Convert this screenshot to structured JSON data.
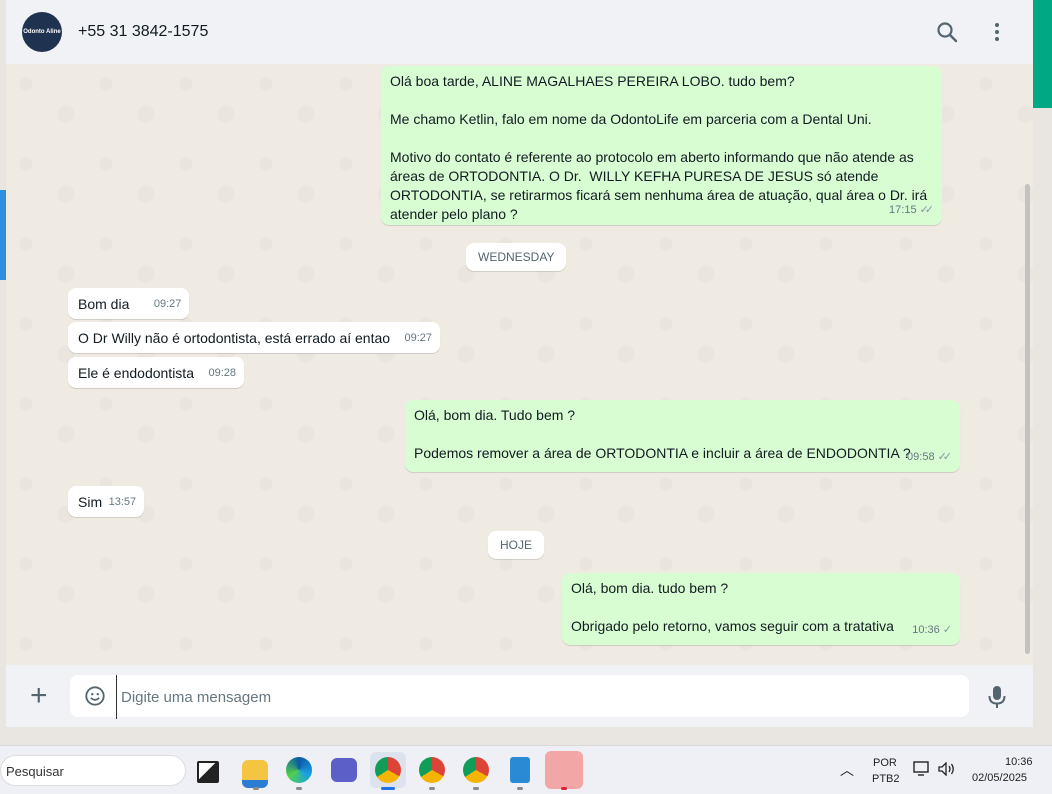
{
  "header": {
    "contact_name": "+55 31 3842-1575",
    "avatar_text": "Odonto Aline"
  },
  "messages": [
    {
      "dir": "out",
      "text": "Olá boa tarde, ALINE MAGALHAES PEREIRA LOBO. tudo bem?\n\nMe chamo Ketlin, falo em nome da OdontoLife em parceria com a Dental Uni.\n\nMotivo do contato é referente ao protocolo em aberto informando que não atende as áreas de ORTODONTIA. O Dr.  WILLY KEFHA PURESA DE JESUS só atende ORTODONTIA, se retirarmos ficará sem nenhuma área de atuação, qual área o Dr. irá atender pelo plano ?",
      "time": "17:15",
      "tick": "✓✓"
    },
    {
      "dir": "in",
      "text": "Bom dia",
      "time": "09:27"
    },
    {
      "dir": "in",
      "text": "O Dr Willy não é ortodontista, está errado aí entao",
      "time": "09:27"
    },
    {
      "dir": "in",
      "text": "Ele é endodontista",
      "time": "09:28"
    },
    {
      "dir": "out",
      "text": "Olá, bom dia. Tudo bem ?\n\nPodemos remover a área de ORTODONTIA e incluir a área de ENDODONTIA ?",
      "time": "09:58",
      "tick": "✓✓"
    },
    {
      "dir": "in",
      "text": "Sim",
      "time": "13:57"
    },
    {
      "dir": "out",
      "text": "Olá, bom dia. tudo bem ?\n\nObrigado pelo retorno, vamos seguir com a tratativa",
      "time": "10:36",
      "tick": "✓"
    }
  ],
  "separators": [
    "WEDNESDAY",
    "HOJE"
  ],
  "composer": {
    "placeholder": "Digite uma mensagem"
  },
  "taskbar": {
    "search_label": "Pesquisar",
    "lang_top": "POR",
    "lang_bottom": "PTB2",
    "clock_time": "10:36",
    "clock_date": "02/05/2025"
  }
}
